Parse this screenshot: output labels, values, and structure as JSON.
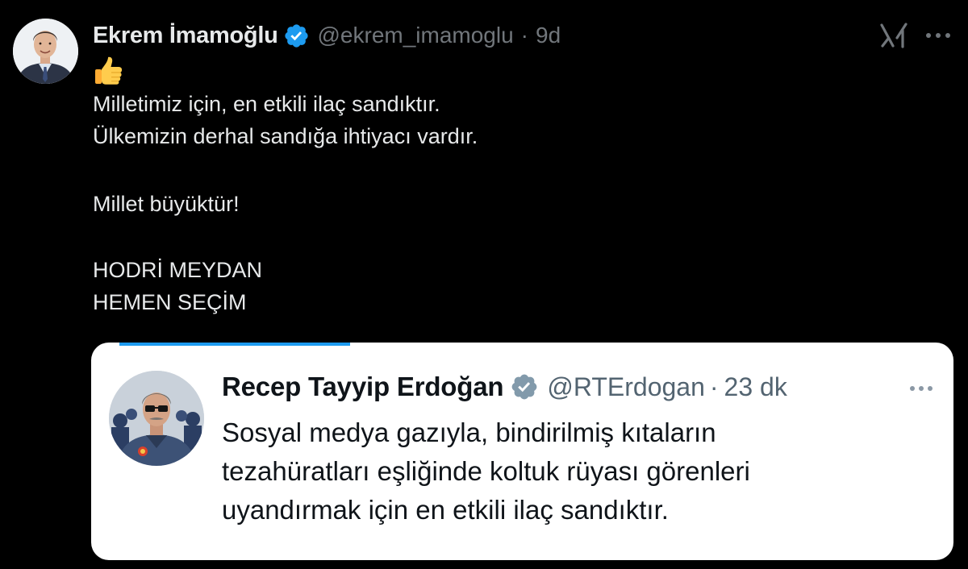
{
  "tweet": {
    "author": {
      "name": "Ekrem İmamoğlu",
      "handle": "@ekrem_imamoglu",
      "verified": true
    },
    "separator": "·",
    "time": "9d",
    "emoji": "thumbs-up",
    "text_lines": [
      "Milletimiz için, en etkili ilaç sandıktır.",
      "Ülkemizin derhal sandığa ihtiyacı vardır.",
      "Millet büyüktür!",
      "HODRİ MEYDAN",
      "HEMEN SEÇİM"
    ]
  },
  "header_icons": {
    "grok": "grok-icon",
    "more": "more-icon"
  },
  "quoted_tweet": {
    "author": {
      "name": "Recep Tayyip Erdoğan",
      "handle": "@RTErdogan",
      "verified": true
    },
    "separator": "·",
    "time": "23 dk",
    "text_lines": [
      "Sosyal medya gazıyla, bindirilmiş kıtaların",
      "tezahüratları eşliğinde koltuk rüyası görenleri",
      "uyandırmak için en etkili ilaç sandıktır."
    ]
  },
  "colors": {
    "background": "#000000",
    "text_primary_dark": "#e7e9ea",
    "text_secondary_dark": "#71767b",
    "verified_blue": "#1d9bf0",
    "quote_background": "#ffffff",
    "quote_text": "#0f1419",
    "quote_secondary": "#536471"
  }
}
